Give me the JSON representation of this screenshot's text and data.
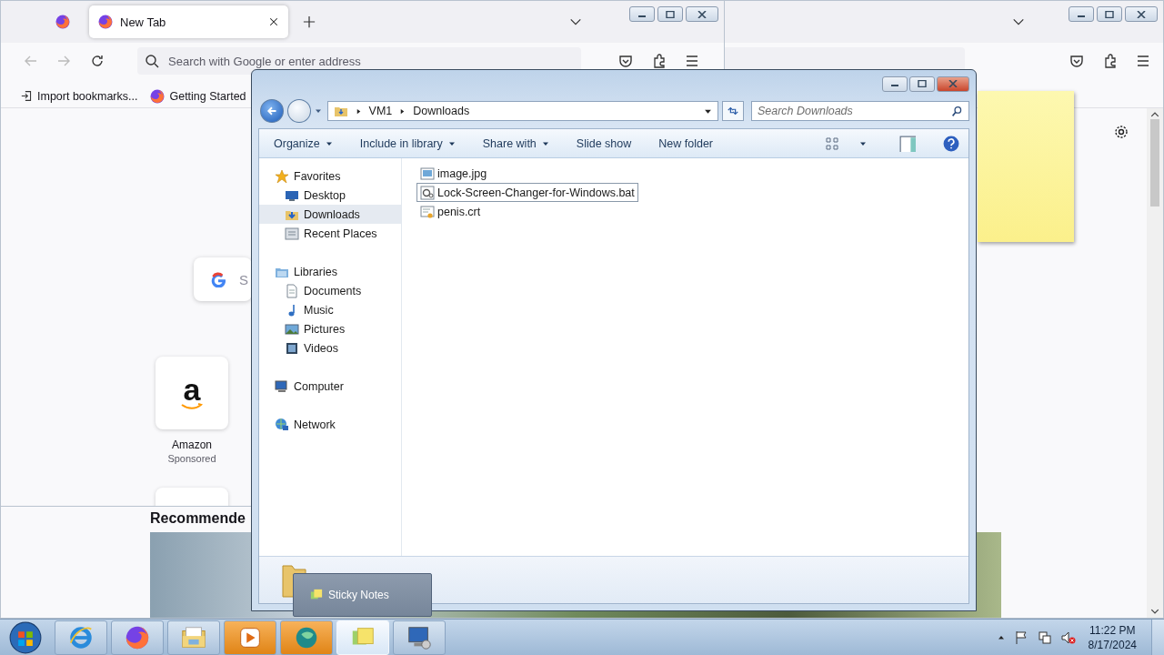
{
  "back_browser": {
    "section_heading": "Recommende"
  },
  "browser": {
    "tabs": [
      {
        "kind": "pinned",
        "selected": false
      },
      {
        "kind": "tab",
        "label": "New Tab",
        "selected": true
      }
    ],
    "address": {
      "placeholder": "Search with Google or enter address"
    },
    "bookmarks": [
      {
        "kind": "import",
        "label": "Import bookmarks..."
      },
      {
        "kind": "firefox",
        "label": "Getting Started"
      }
    ],
    "search_hint": "S",
    "shortcuts": [
      {
        "logo_text": "a",
        "label": "Amazon",
        "sublabel": "Sponsored"
      }
    ]
  },
  "explorer": {
    "breadcrumbs": [
      "VM1",
      "Downloads"
    ],
    "search": {
      "placeholder": "Search Downloads"
    },
    "commands": [
      {
        "label": "Organize",
        "menu": true
      },
      {
        "label": "Include in library",
        "menu": true
      },
      {
        "label": "Share with",
        "menu": true
      },
      {
        "label": "Slide show",
        "menu": false
      },
      {
        "label": "New folder",
        "menu": false
      }
    ],
    "nav": [
      {
        "kind": "star",
        "label": "Favorites",
        "selected": false,
        "children": [
          {
            "kind": "desktop",
            "label": "Desktop",
            "selected": false
          },
          {
            "kind": "downloads",
            "label": "Downloads",
            "selected": true
          },
          {
            "kind": "recent",
            "label": "Recent Places",
            "selected": false
          }
        ]
      },
      {
        "kind": "libraries",
        "label": "Libraries",
        "selected": false,
        "children": [
          {
            "kind": "documents",
            "label": "Documents",
            "selected": false
          },
          {
            "kind": "music",
            "label": "Music",
            "selected": false
          },
          {
            "kind": "pictures",
            "label": "Pictures",
            "selected": false
          },
          {
            "kind": "videos",
            "label": "Videos",
            "selected": false
          }
        ]
      },
      {
        "kind": "computer",
        "label": "Computer",
        "selected": false
      },
      {
        "kind": "network",
        "label": "Network",
        "selected": false
      }
    ],
    "files": [
      {
        "kind": "image",
        "name": "image.jpg",
        "focused": false
      },
      {
        "kind": "script",
        "name": "Lock-Screen-Changer-for-Windows.bat",
        "focused": true
      },
      {
        "kind": "certificate",
        "name": "penis.crt",
        "focused": false
      }
    ]
  },
  "tooltip": {
    "label": "Sticky Notes"
  },
  "taskbar": {
    "apps": [
      {
        "kind": "ie",
        "selected": false
      },
      {
        "kind": "firefox",
        "selected": false
      },
      {
        "kind": "explorer",
        "selected": false
      },
      {
        "kind": "media",
        "selected": false
      },
      {
        "kind": "globe",
        "selected": false
      },
      {
        "kind": "notes",
        "selected": true
      },
      {
        "kind": "remote",
        "selected": false
      }
    ],
    "clock": {
      "time": "11:22 PM",
      "date": "8/17/2024"
    }
  }
}
